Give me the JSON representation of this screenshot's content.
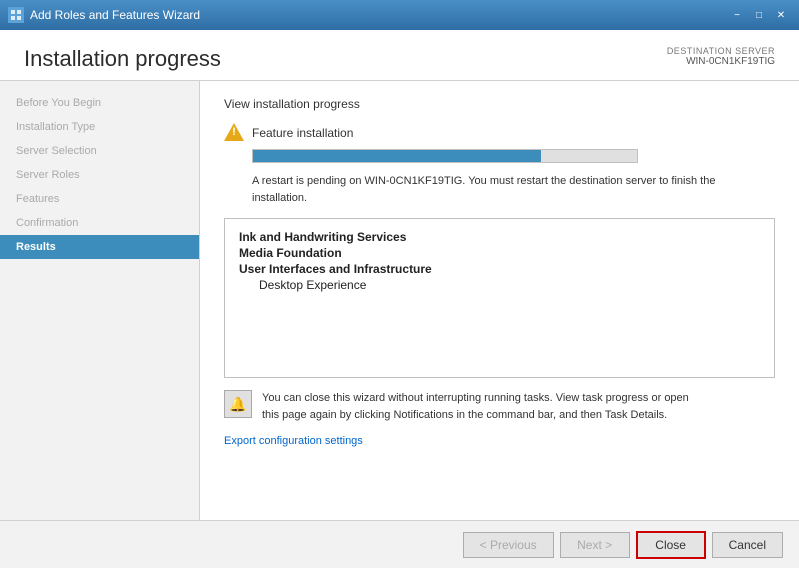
{
  "titleBar": {
    "title": "Add Roles and Features Wizard",
    "minimizeLabel": "−",
    "maximizeLabel": "□",
    "closeLabel": "✕"
  },
  "header": {
    "title": "Installation progress",
    "destinationServerLabel": "DESTINATION SERVER",
    "destinationServerValue": "WIN-0CN1KF19TIG"
  },
  "sidebar": {
    "items": [
      {
        "label": "Before You Begin",
        "state": "disabled"
      },
      {
        "label": "Installation Type",
        "state": "disabled"
      },
      {
        "label": "Server Selection",
        "state": "disabled"
      },
      {
        "label": "Server Roles",
        "state": "disabled"
      },
      {
        "label": "Features",
        "state": "disabled"
      },
      {
        "label": "Confirmation",
        "state": "disabled"
      },
      {
        "label": "Results",
        "state": "active"
      }
    ]
  },
  "main": {
    "sectionTitle": "View installation progress",
    "featureInstallLabel": "Feature installation",
    "progressPercent": 75,
    "restartMessage": "A restart is pending on WIN-0CN1KF19TIG. You must restart the destination server to finish the installation.",
    "installedFeatures": [
      {
        "label": "Ink and Handwriting Services",
        "bold": true,
        "indent": false
      },
      {
        "label": "Media Foundation",
        "bold": true,
        "indent": false
      },
      {
        "label": "User Interfaces and Infrastructure",
        "bold": true,
        "indent": false
      },
      {
        "label": "Desktop Experience",
        "bold": false,
        "indent": true
      }
    ],
    "infoText": "You can close this wizard without interrupting running tasks. View task progress or open this page again by clicking Notifications in the command bar, and then Task Details.",
    "exportLinkLabel": "Export configuration settings"
  },
  "footer": {
    "previousLabel": "< Previous",
    "nextLabel": "Next >",
    "closeLabel": "Close",
    "cancelLabel": "Cancel"
  }
}
